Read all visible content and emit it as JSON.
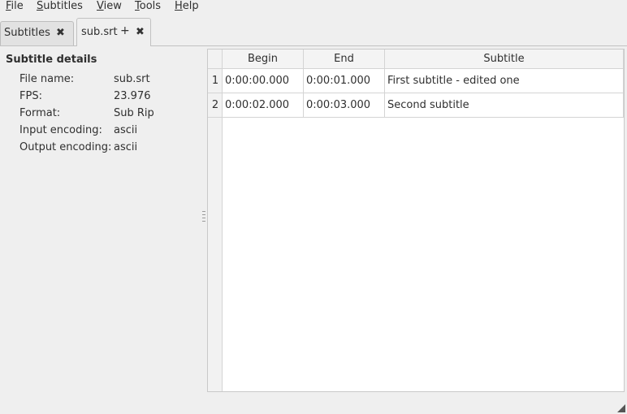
{
  "menu": {
    "items": [
      {
        "label": "File",
        "mnemonic": "F"
      },
      {
        "label": "Subtitles",
        "mnemonic": "S"
      },
      {
        "label": "View",
        "mnemonic": "V"
      },
      {
        "label": "Tools",
        "mnemonic": "T"
      },
      {
        "label": "Help",
        "mnemonic": "H"
      }
    ]
  },
  "tabs": [
    {
      "label": "Subtitles",
      "active": false,
      "modified": false
    },
    {
      "label": "sub.srt",
      "active": true,
      "modified": true,
      "modified_mark": "+"
    }
  ],
  "details": {
    "title": "Subtitle details",
    "fields": [
      {
        "label": "File name:",
        "value": "sub.srt"
      },
      {
        "label": "FPS:",
        "value": "23.976"
      },
      {
        "label": "Format:",
        "value": "Sub Rip"
      },
      {
        "label": "Input encoding:",
        "value": "ascii"
      },
      {
        "label": "Output encoding:",
        "value": "ascii"
      }
    ]
  },
  "table": {
    "columns": [
      "Begin",
      "End",
      "Subtitle"
    ],
    "rows": [
      {
        "num": "1",
        "begin": "0:00:00.000",
        "end": "0:00:01.000",
        "text": "First subtitle - edited one"
      },
      {
        "num": "2",
        "begin": "0:00:02.000",
        "end": "0:00:03.000",
        "text": "Second subtitle"
      }
    ]
  },
  "icons": {
    "close": "close-icon",
    "splitter": "splitter-handle-icon",
    "grip": "resize-grip-icon"
  },
  "colors": {
    "window_bg": "#efefef",
    "table_bg": "#ffffff",
    "header_bg": "#f4f4f4",
    "grid": "#d4d4d4"
  }
}
